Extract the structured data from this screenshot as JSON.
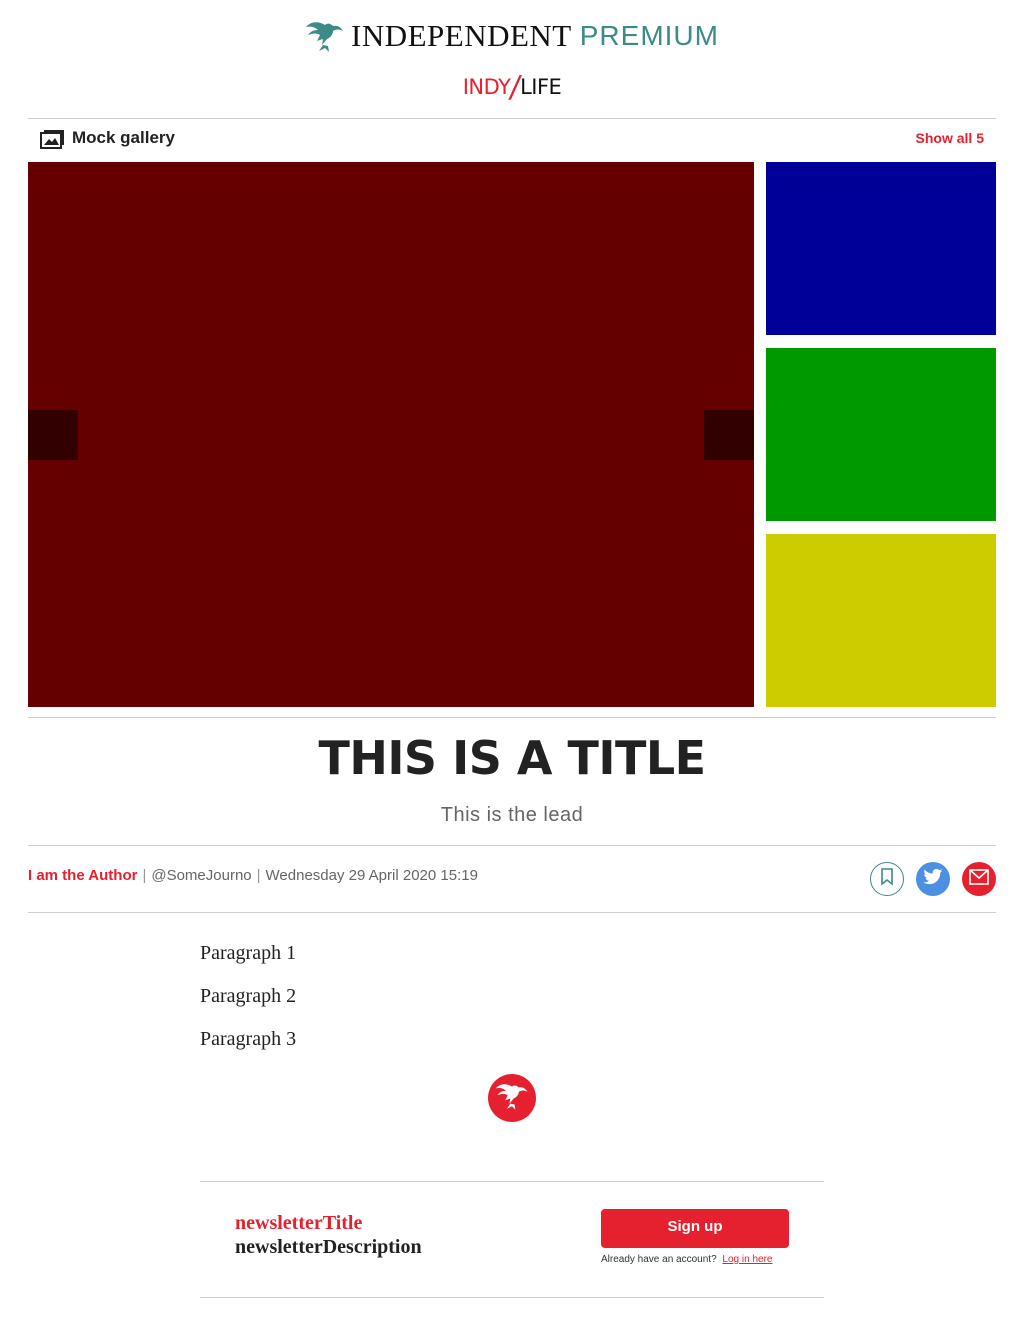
{
  "masthead": {
    "brand_name": "INDEPENDENT",
    "brand_tier": "PREMIUM",
    "logo_icon": "eagle-icon",
    "section": {
      "part1": "INDY",
      "slash": "/",
      "part2": "LIFE"
    }
  },
  "gallery": {
    "icon": "gallery-icon",
    "title": "Mock gallery",
    "show_all_label": "Show all 5",
    "main_image_color": "#650000",
    "thumbnail_colors": [
      "#000099",
      "#009900",
      "#cccc00"
    ]
  },
  "article": {
    "title": "THIS IS A TITLE",
    "lead": "This is the lead",
    "byline": {
      "author": "I am the Author",
      "handle": "@SomeJourno",
      "date": "Wednesday 29 April 2020 15:19",
      "separator": "|"
    },
    "share_icons": [
      "bookmark-icon",
      "twitter-icon",
      "email-icon"
    ],
    "paragraphs": [
      "Paragraph 1",
      "Paragraph 2",
      "Paragraph 3"
    ],
    "end_mark_icon": "eagle-icon"
  },
  "newsletter": {
    "title": "newsletterTitle",
    "description": "newsletterDescription",
    "signup_label": "Sign up",
    "account_prompt": "Already have an account?",
    "login_label": "Log in here"
  },
  "colors": {
    "accent_red": "#e5202f",
    "premium_teal": "#3e8a87",
    "twitter_blue": "#4b90e2"
  }
}
